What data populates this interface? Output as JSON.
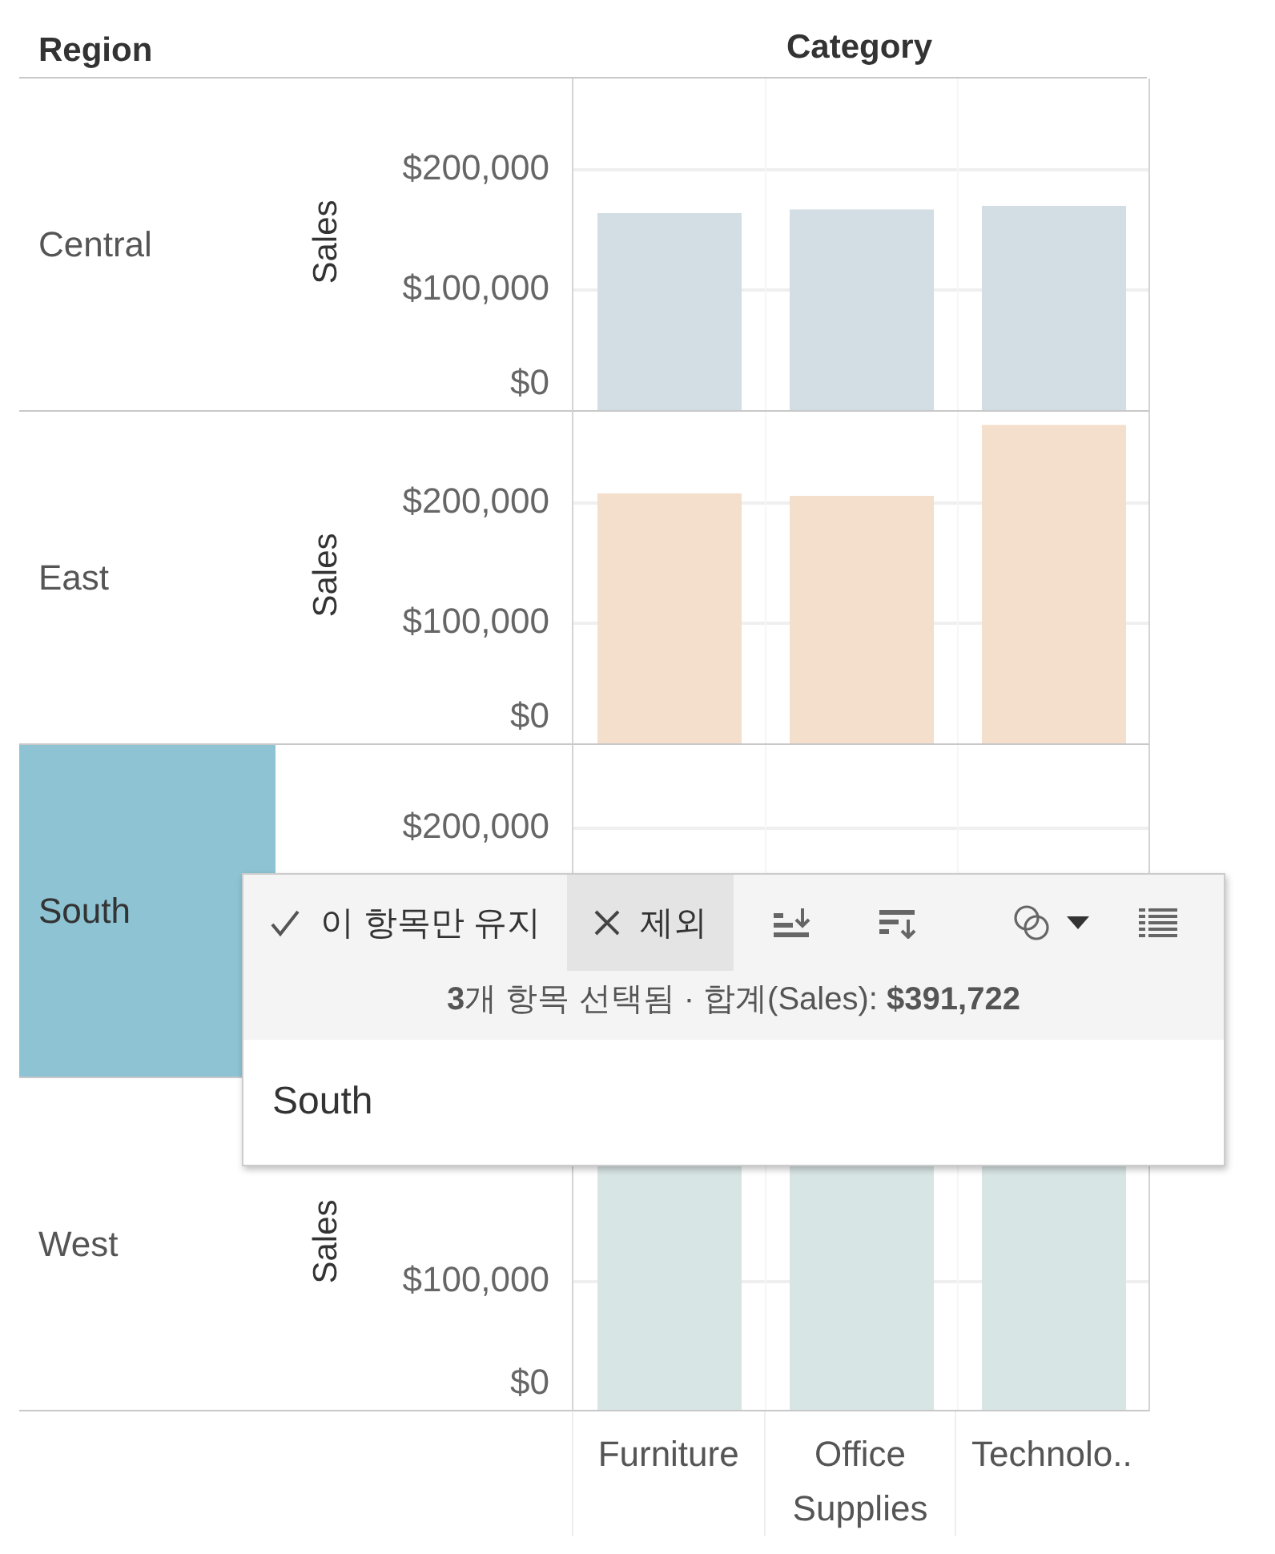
{
  "row_header": "Region",
  "column_header": "Category",
  "panels": [
    {
      "region": "Central",
      "selected": false,
      "chart_data": {
        "type": "bar",
        "ylabel": "Sales",
        "ylim": [
          0,
          276000
        ],
        "yticks": [
          {
            "value": 0,
            "label": "$0"
          },
          {
            "value": 100000,
            "label": "$100,000"
          },
          {
            "value": 200000,
            "label": "$200,000"
          }
        ],
        "series": [
          {
            "color": "#d3dde4",
            "values": [
              164000,
              167000,
              170000
            ]
          }
        ]
      }
    },
    {
      "region": "East",
      "selected": false,
      "chart_data": {
        "type": "bar",
        "ylabel": "Sales",
        "ylim": [
          0,
          276000
        ],
        "yticks": [
          {
            "value": 0,
            "label": "$0"
          },
          {
            "value": 100000,
            "label": "$100,000"
          },
          {
            "value": 200000,
            "label": "$200,000"
          }
        ],
        "series": [
          {
            "color": "#f3dfcb",
            "values": [
              208000,
              206000,
              265000
            ]
          }
        ]
      }
    },
    {
      "region": "South",
      "selected": true,
      "kind": "upper_visible",
      "tick_labels": [
        "$200,000"
      ]
    },
    {
      "region": "West",
      "selected": false,
      "kind": "lower_visible",
      "axis_title": "Sales",
      "tick_labels": [
        "$100,000",
        "$0"
      ],
      "categories": [
        "Furniture",
        "Office Supplies",
        "Technolo.."
      ]
    }
  ],
  "tooltip": {
    "actions": [
      {
        "kind": "keep",
        "label": "이 항목만 유지",
        "selected": false
      },
      {
        "kind": "exclude",
        "label": "제외",
        "selected": true
      }
    ],
    "summary": "**3**개 항목 선택됨 · 합계(Sales): **$391,722**",
    "item": "South"
  }
}
